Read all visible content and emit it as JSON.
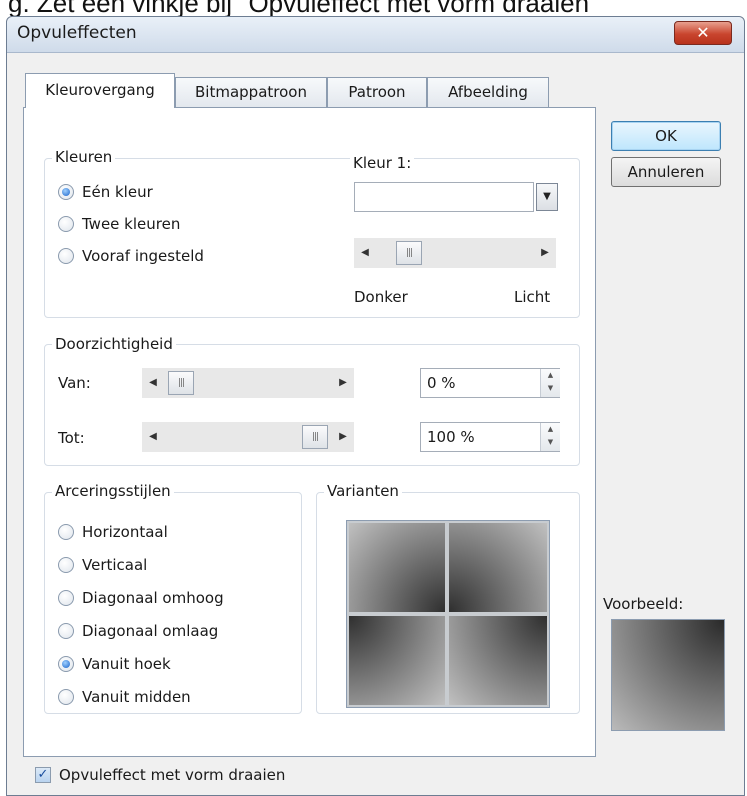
{
  "caption": "g. Zet een vinkje bij \"Opvuleffect met vorm draaien\"",
  "window": {
    "title": "Opvuleffecten",
    "close_symbol": "✕"
  },
  "tabs": [
    "Kleurovergang",
    "Bitmappatroon",
    "Patroon",
    "Afbeelding"
  ],
  "colors_group": {
    "label": "Kleuren",
    "options": [
      "Eén kleur",
      "Twee kleuren",
      "Vooraf ingesteld"
    ],
    "selected_index": 0,
    "color1_label": "Kleur 1:",
    "color1_value": "",
    "slider_left_label": "Donker",
    "slider_right_label": "Licht"
  },
  "transparency_group": {
    "label": "Doorzichtigheid",
    "from_label": "Van:",
    "from_value": "0 %",
    "to_label": "Tot:",
    "to_value": "100 %"
  },
  "shading_group": {
    "label": "Arceringsstijlen",
    "options": [
      "Horizontaal",
      "Verticaal",
      "Diagonaal omhoog",
      "Diagonaal omlaag",
      "Vanuit hoek",
      "Vanuit midden"
    ],
    "selected_index": 4
  },
  "variants_group": {
    "label": "Varianten"
  },
  "buttons": {
    "ok": "OK",
    "cancel": "Annuleren"
  },
  "preview_label": "Voorbeeld:",
  "rotate_checkbox": {
    "label": "Opvuleffect met vorm draaien",
    "checked": true
  },
  "icons": {
    "dropdown": "▼",
    "arrow_left": "◀",
    "arrow_right": "▶",
    "spin_up": "▲",
    "spin_down": "▼",
    "check": "✓",
    "grip": "|||"
  }
}
